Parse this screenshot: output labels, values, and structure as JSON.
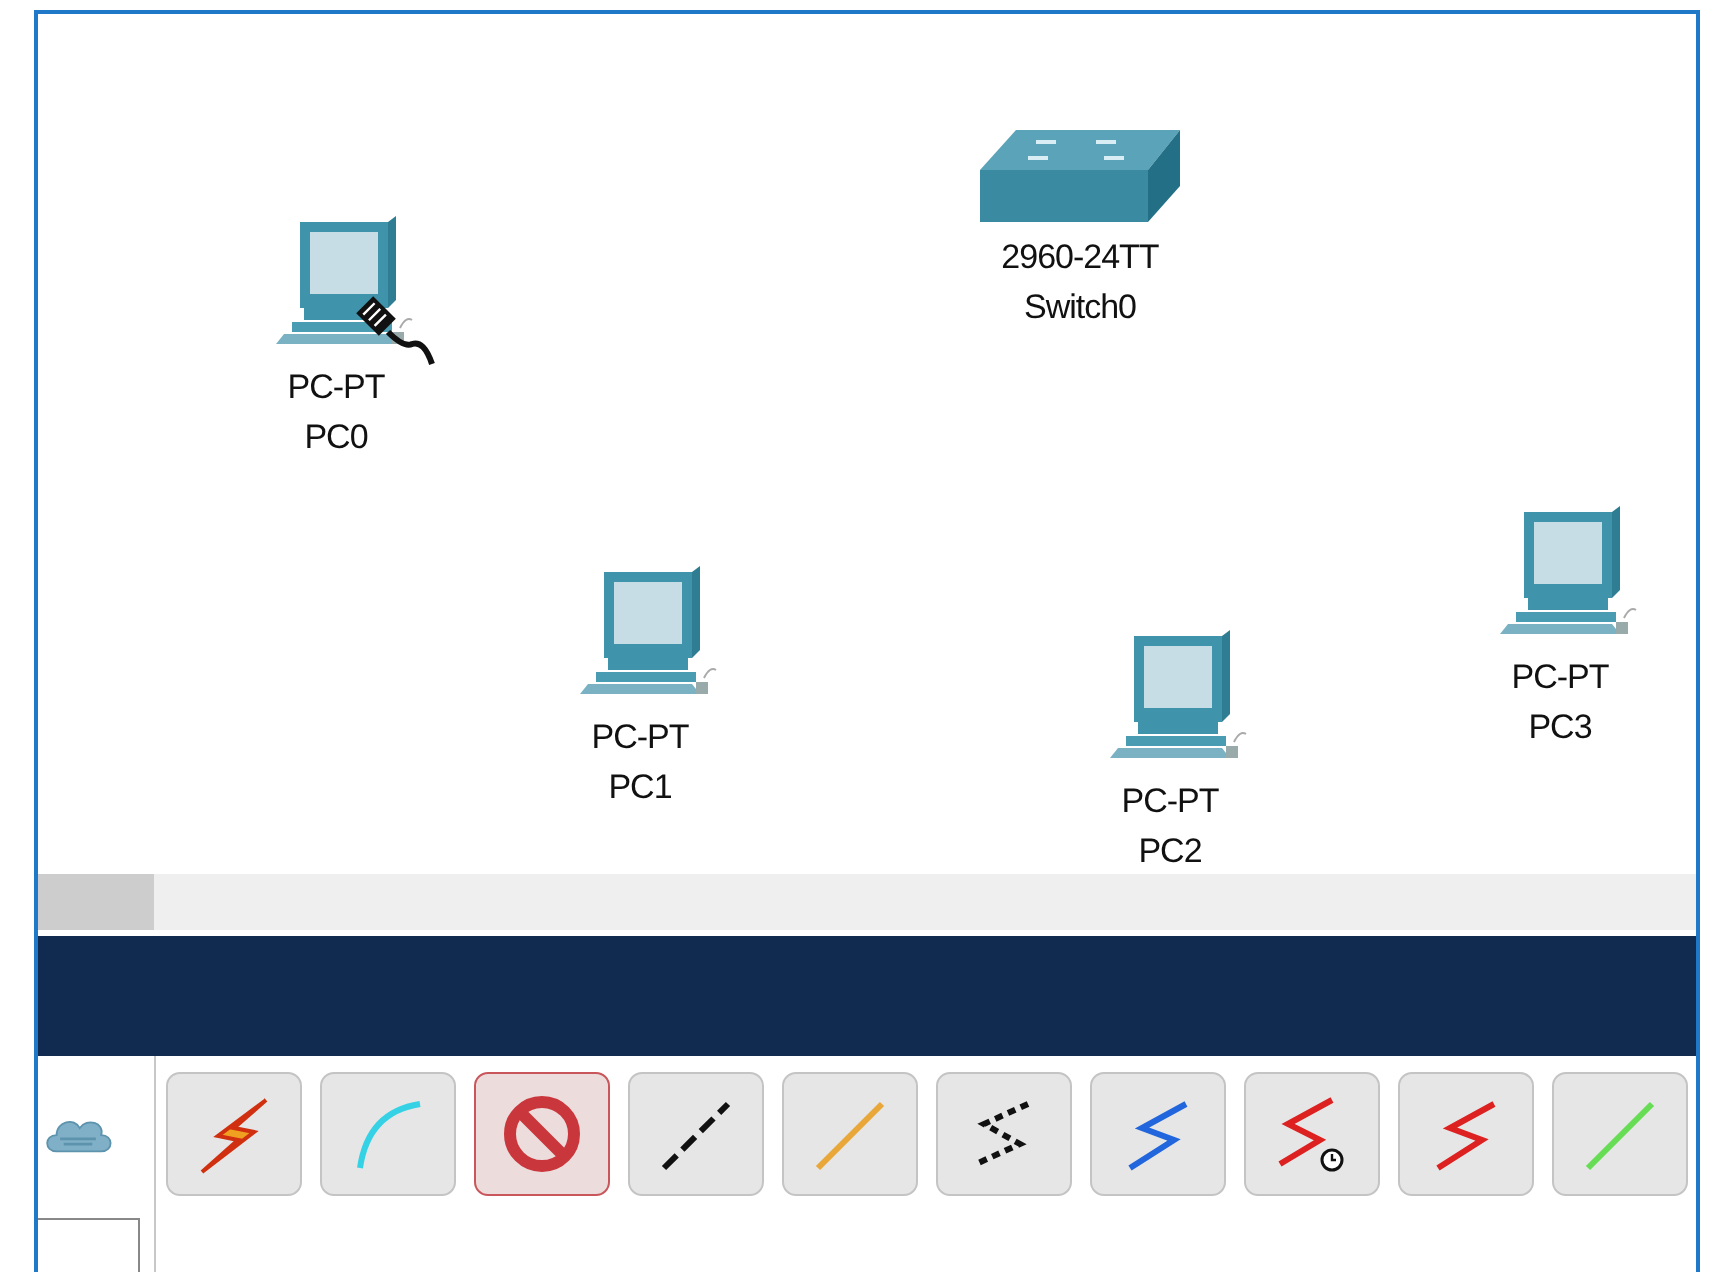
{
  "devices": [
    {
      "kind": "pc",
      "model": "PC-PT",
      "name": "PC0",
      "cable_cursor": true
    },
    {
      "kind": "switch",
      "model": "2960-24TT",
      "name": "Switch0",
      "cable_cursor": false
    },
    {
      "kind": "pc",
      "model": "PC-PT",
      "name": "PC1",
      "cable_cursor": false
    },
    {
      "kind": "pc",
      "model": "PC-PT",
      "name": "PC2",
      "cable_cursor": false
    },
    {
      "kind": "pc",
      "model": "PC-PT",
      "name": "PC3",
      "cable_cursor": false
    }
  ],
  "connections": [
    {
      "kind": "automatic",
      "selected": false
    },
    {
      "kind": "console",
      "selected": false
    },
    {
      "kind": "none",
      "selected": true
    },
    {
      "kind": "straight",
      "selected": false
    },
    {
      "kind": "fiber",
      "selected": false
    },
    {
      "kind": "phone",
      "selected": false
    },
    {
      "kind": "coaxial",
      "selected": false
    },
    {
      "kind": "serial-clock",
      "selected": false
    },
    {
      "kind": "serial",
      "selected": false
    },
    {
      "kind": "green-line",
      "selected": false
    }
  ]
}
